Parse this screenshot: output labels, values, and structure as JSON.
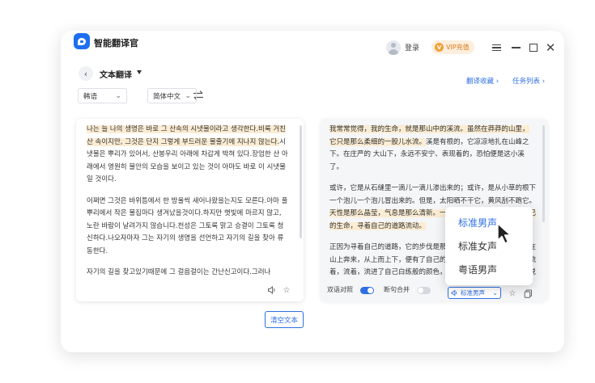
{
  "app": {
    "title": "智能翻译官"
  },
  "header": {
    "login_label": "登录",
    "vip_icon": "V",
    "vip_label": "VIP充值"
  },
  "toolbar": {
    "section_title": "文本翻译",
    "favorites_link": "翻译收藏 ›",
    "tasks_link": "任务列表 ›"
  },
  "languages": {
    "source": "韩语",
    "target": "简体中文"
  },
  "source_text": {
    "p1_highlight": "나는 늘 나의 생명은 바로 그 산속의 시냇물이라고 생각한다.비록 거친 산 속이지만, 그것은 단지 그렇게 부드러운 물줄기에 지나지 않는다.",
    "p1_rest": "시냇물은 뿌리가 있어서, 산봉우리 아래에 차갑게 박혀 있다.장엄한 산 아래에서 영원히 불안의 모습을 보이고 있는 것이 아마도 바로 이 시냇물일 것이다.",
    "p2": "어쩌면 그것은 바위틈에서 한 방울씩 새어나왔을는지도 모른다.아마 풀뿌리에서 작은 물집마다 생겨났을것이다.하지만 햇빛에 마르지 않고, 노란 바람이 날려가지 않습니다.천성은 그토록 맑고 승결이 그토록 청신하다.나오자마자 그는 자기의 생명을 선언하고 자기의 길을 찾아 류동한다.",
    "p3": "자기의 길을 찾고있기때문에 그 걸음걸이는 간난신고이다.그러나"
  },
  "target_text": {
    "p1_a": "我常常觉得，我的生命，就是那山中的溪流。",
    "p1_b": "虽然在莽莽的山里，它只是那么柔细的一股儿水流。",
    "p1_c": "溪是有根的，它凉凉地扎在山峰之下。在庄严的 大山下，永远不安宁、表现着的，恐怕便是这小溪了。",
    "p2_a": "或许，它是从石缝里一滴儿一滴儿渗出来的；或许，是从小草的根下一个泡儿一个泡儿冒出来的。但是，太阳晒不干它，黄风刮不跑它。",
    "p2_b": "天性是那么晶莹，气息是那么清新。一出来，它就向世界宣告了自己的生命，寻着自己的道路流动。",
    "p3": "正因为寻着自己的道路，它的步伐是那么艰辛。但它并不惧怕。它在山上奔来，从上而上下，便有了自己的明的韵味的声音。它流着，流着，流着，流进了自己白练般的颜色，它同旅途上的每一块石头都说话。"
  },
  "target_footer": {
    "bilingual_label": "双语对照",
    "merge_label": "断句合并",
    "voice_selected": "标准男声"
  },
  "actions": {
    "clear_label": "清空文本"
  },
  "voice_options": [
    "标准男声",
    "标准女声",
    "粤语男声"
  ],
  "colors": {
    "accent": "#2f6fe4",
    "highlight": "#fbecd3",
    "vip": "#f0a23a"
  }
}
